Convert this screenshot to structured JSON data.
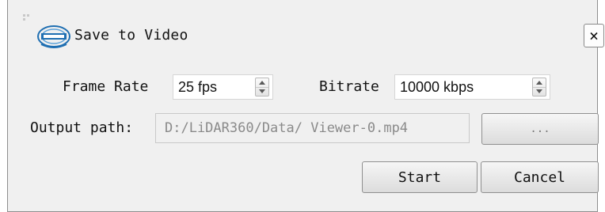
{
  "window": {
    "title": "Save to Video",
    "close_symbol": "×"
  },
  "form": {
    "frame_rate_label": "Frame Rate",
    "frame_rate_value": "25 fps",
    "bitrate_label": "Bitrate",
    "bitrate_value": "10000 kbps",
    "output_path_label": "Output path:",
    "output_path_value": "D:/LiDAR360/Data/ Viewer-0.mp4",
    "browse_label": "..."
  },
  "actions": {
    "start_label": "Start",
    "cancel_label": "Cancel"
  },
  "icons": {
    "app_logo": "lidar360-logo-icon",
    "spinner": "spin-arrows-icon"
  },
  "colors": {
    "dialog_bg": "#f0f0f0",
    "field_bg": "#ffffff",
    "disabled_text": "#8a8a8a",
    "logo_blue": "#1f6fb2"
  }
}
